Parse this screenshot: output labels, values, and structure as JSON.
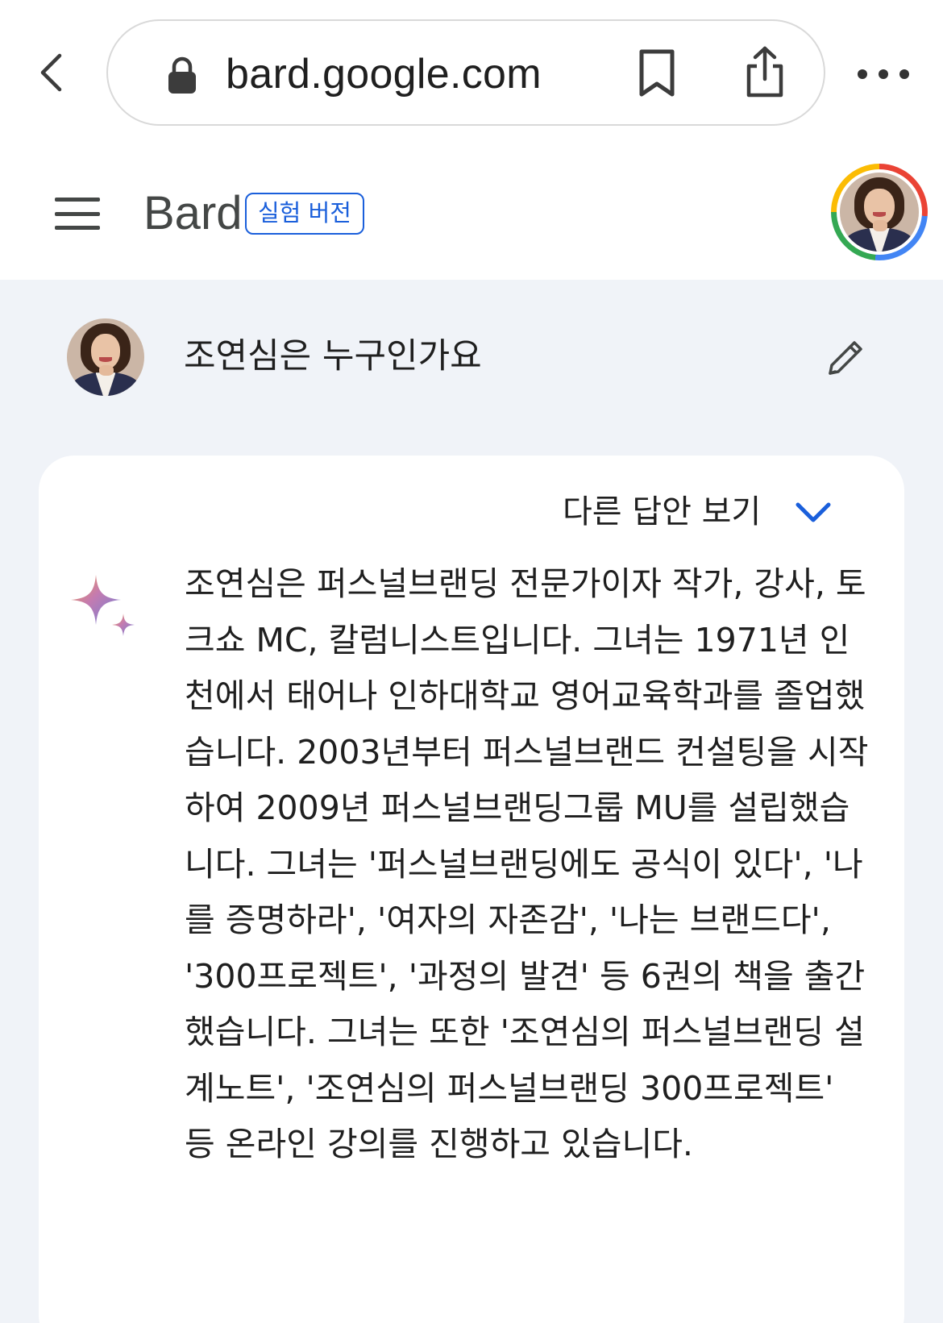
{
  "browser": {
    "url": "bard.google.com",
    "back_icon": "chevron-left-icon",
    "lock_icon": "lock-icon",
    "bookmark_icon": "bookmark-icon",
    "share_icon": "share-icon",
    "more_icon": "more-horizontal-icon"
  },
  "header": {
    "app_name": "Bard",
    "badge": "실험 버전",
    "menu_icon": "hamburger-menu-icon",
    "avatar_ring_colors": [
      "#ea4335",
      "#4285f4",
      "#34a853",
      "#fbbc04"
    ]
  },
  "conversation": {
    "user_query": "조연심은 누구인가요",
    "edit_icon": "pencil-icon",
    "drafts_label": "다른 답안 보기",
    "drafts_icon": "chevron-down-icon",
    "response_icon": "bard-sparkle-icon",
    "response_text": "조연심은 퍼스널브랜딩 전문가이자 작가, 강사, 토크쇼 MC, 칼럼니스트입니다. 그녀는 1971년 인천에서 태어나 인하대학교 영어교육학과를 졸업했습니다. 2003년부터 퍼스널브랜드 컨설팅을 시작하여 2009년 퍼스널브랜딩그룹 MU를 설립했습니다. 그녀는 '퍼스널브랜딩에도 공식이 있다', '나를 증명하라', '여자의 자존감', '나는 브랜드다', '300프로젝트', '과정의 발견' 등 6권의 책을 출간했습니다. 그녀는 또한 '조연심의 퍼스널브랜딩 설계노트', '조연심의 퍼스널브랜딩 300프로젝트' 등 온라인 강의를 진행하고 있습니다."
  },
  "colors": {
    "accent_blue": "#1a5fdb",
    "background": "#f0f3f8",
    "card": "#ffffff"
  }
}
